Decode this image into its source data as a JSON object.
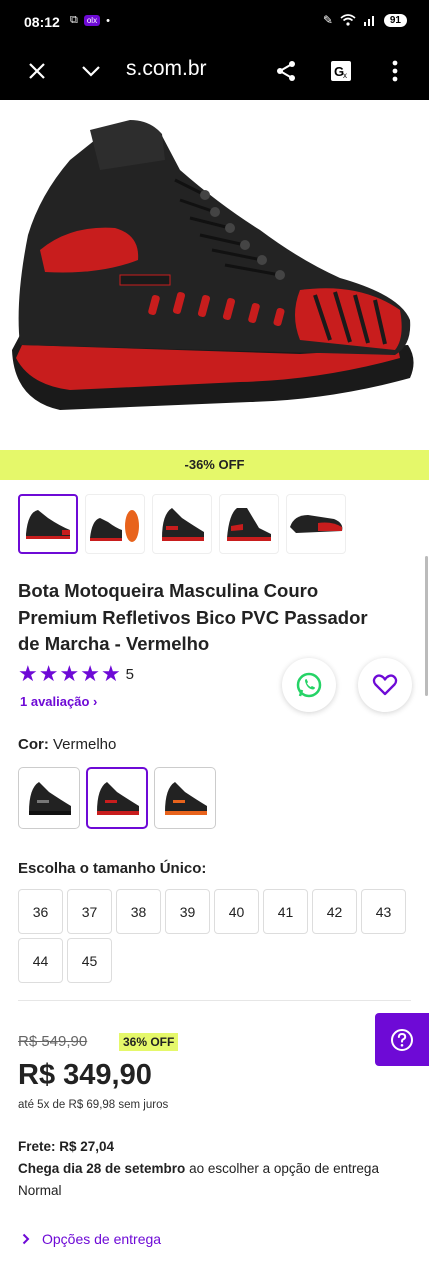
{
  "status_bar": {
    "time": "08:12",
    "app_badge": "olx",
    "battery": "91"
  },
  "browser": {
    "url": "s.com.br"
  },
  "product": {
    "discount_banner": "-36% OFF",
    "title": "Bota Motoqueira Masculina Couro Premium Refletivos Bico PVC Passador de Marcha - Vermelho",
    "rating_value": "5",
    "rating_fraction": 1.0,
    "review_link": "1 avaliação",
    "color_label": "Cor:",
    "color_value": "Vermelho",
    "size_label": "Escolha o tamanho Único:",
    "sizes": [
      "36",
      "37",
      "38",
      "39",
      "40",
      "41",
      "42",
      "43",
      "44",
      "45"
    ],
    "old_price": "R$ 549,90",
    "off_badge": "36% OFF",
    "price": "R$ 349,90",
    "installments": "até 5x de R$ 69,98 sem juros",
    "shipping_line": "Frete: R$ 27,04",
    "arrival_bold": "Chega dia 28 de setembro",
    "arrival_rest": " ao escolher a opção de entrega Normal",
    "delivery_options_link": "Opções de entrega"
  },
  "colors": {
    "accent": "#6e0ad6",
    "discount_bg": "#e5f86a",
    "whatsapp": "#25d366"
  },
  "icons": {
    "close": "close-icon",
    "collapse": "chevron-down-icon",
    "share": "share-icon",
    "translate": "translate-icon",
    "menu": "more-vert-icon",
    "whatsapp": "whatsapp-icon",
    "favorite": "heart-icon",
    "help": "help-icon"
  }
}
